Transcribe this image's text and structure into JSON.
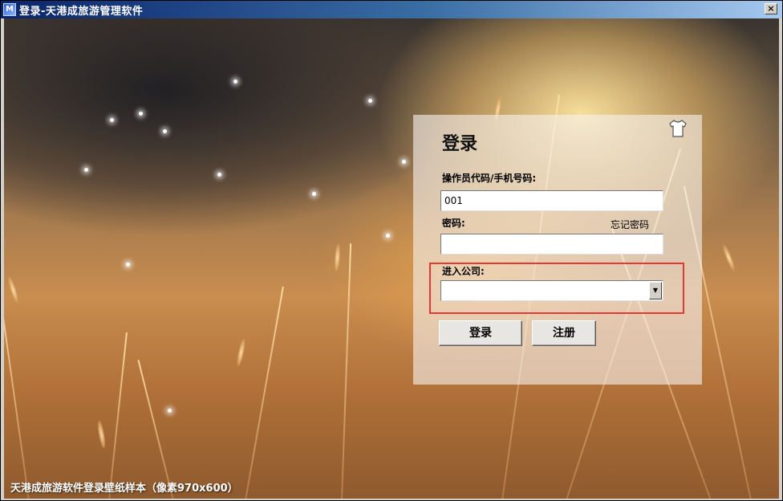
{
  "window": {
    "title": "登录-天港成旅游管理软件",
    "close_label": "×"
  },
  "login": {
    "title": "登录",
    "operator_label": "操作员代码/手机号码:",
    "operator_value": "001",
    "password_label": "密码:",
    "password_value": "",
    "forgot_label": "忘记密码",
    "company_label": "进入公司:",
    "company_value": "",
    "login_button": "登录",
    "register_button": "注册"
  },
  "caption": "天港成旅游软件登录壁纸样本（像素970x600）",
  "icons": {
    "app": "app-logo-icon",
    "skin": "tshirt-icon",
    "dropdown": "chevron-down-icon"
  },
  "colors": {
    "highlight": "#e53935",
    "titlebar_start": "#0a246a",
    "titlebar_end": "#a6caf0"
  }
}
